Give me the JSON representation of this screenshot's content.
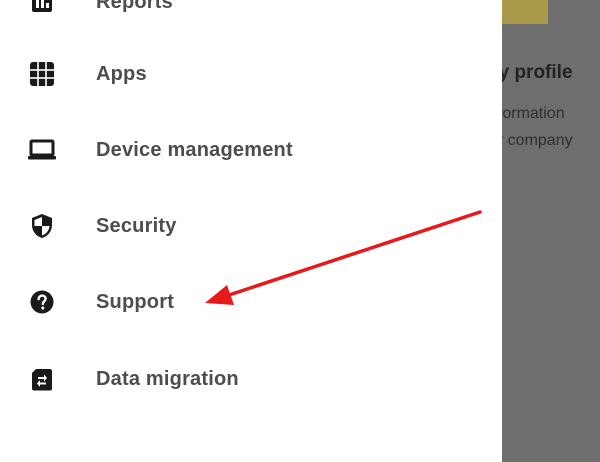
{
  "background": {
    "title": "ny profile",
    "desc_line1": "nformation",
    "desc_line2": "ur company"
  },
  "sidebar": {
    "items": [
      {
        "label": "Reports",
        "icon": "reports-icon"
      },
      {
        "label": "Apps",
        "icon": "apps-grid-icon"
      },
      {
        "label": "Device management",
        "icon": "laptop-icon"
      },
      {
        "label": "Security",
        "icon": "shield-icon"
      },
      {
        "label": "Support",
        "icon": "help-circle-icon"
      },
      {
        "label": "Data migration",
        "icon": "data-migration-icon"
      }
    ]
  },
  "colors": {
    "drawer_bg": "#ffffff",
    "overlay": "#6e6e6e",
    "label": "#4d4d4d",
    "icon": "#1a1a1a",
    "annotation": "#e8191c",
    "accent": "#a89a4a"
  }
}
